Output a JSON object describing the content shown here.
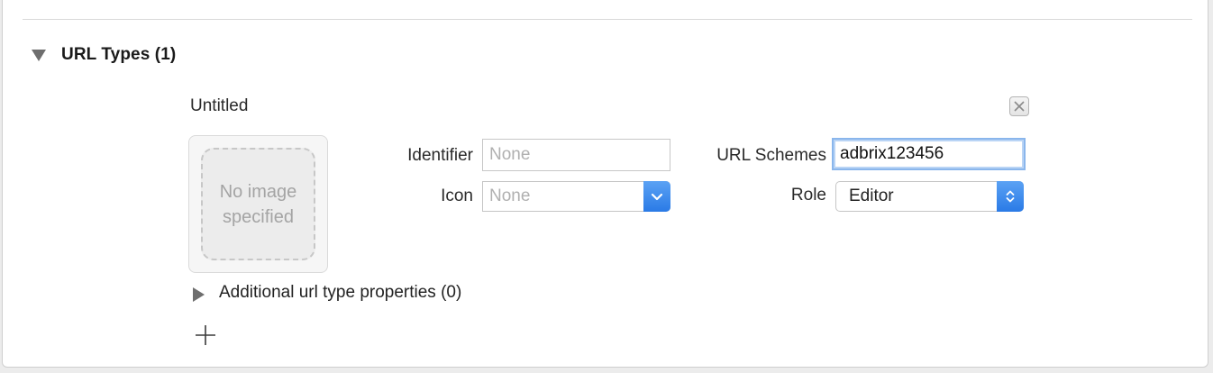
{
  "section": {
    "title": "URL Types (1)",
    "expanded": true
  },
  "entry": {
    "title": "Untitled",
    "image_placeholder": "No image specified",
    "identifier": {
      "label": "Identifier",
      "value": "",
      "placeholder": "None"
    },
    "icon": {
      "label": "Icon",
      "value": "",
      "placeholder": "None"
    },
    "url_schemes": {
      "label": "URL Schemes",
      "value": "adbrix123456"
    },
    "role": {
      "label": "Role",
      "value": "Editor"
    },
    "additional": {
      "label": "Additional url type properties (0)",
      "expanded": false
    }
  },
  "icons": {
    "section_disclosure": "disclosure-triangle-down-icon",
    "remove": "close-icon",
    "icon_dropdown": "chevron-down-icon",
    "role_dropdown": "up-down-chevron-icon",
    "additional_disclosure": "disclosure-triangle-right-icon",
    "add": "plus-icon"
  },
  "colors": {
    "accent": "#2a7ae6",
    "focus_ring": "#8ab6ec",
    "placeholder_text": "#b0b0b0"
  }
}
